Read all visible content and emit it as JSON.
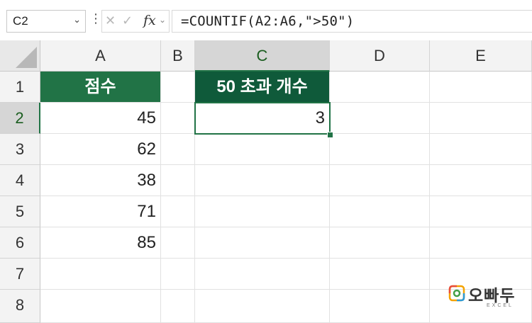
{
  "formula_bar": {
    "name_box": "C2",
    "dots": "⋮",
    "fx_label": "fx",
    "formula": "=COUNTIF(A2:A6,\">50\")"
  },
  "columns": [
    "A",
    "B",
    "C",
    "D",
    "E"
  ],
  "rows": [
    "1",
    "2",
    "3",
    "4",
    "5",
    "6",
    "7",
    "8"
  ],
  "cells": {
    "A1": "점수",
    "A2": "45",
    "A3": "62",
    "A4": "38",
    "A5": "71",
    "A6": "85",
    "C1": "50 초과 개수",
    "C2": "3"
  },
  "selected": {
    "cell": "C2",
    "column": "C",
    "row": "2"
  },
  "colors": {
    "header_fill_a": "#217346",
    "header_fill_c": "#0f5a3a",
    "selection": "#217346"
  },
  "logo": {
    "text": "오빠두",
    "sub": "EXCEL"
  }
}
